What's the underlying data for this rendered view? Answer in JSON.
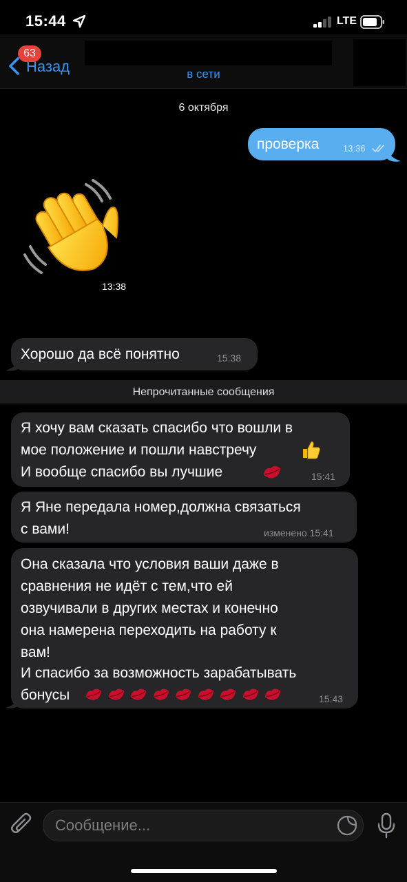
{
  "status_bar": {
    "time": "15:44",
    "network": "LTE"
  },
  "header": {
    "back_badge": "63",
    "back_label": "Назад",
    "contact_status": "в сети"
  },
  "chat": {
    "date_separator": "6 октября",
    "outgoing": {
      "text": "проверка",
      "time": "13:36"
    },
    "sticker": {
      "time": "13:38",
      "icon": "waving-hand"
    },
    "incoming_1": {
      "text": "Хорошо да всё понятно",
      "time": "15:38"
    },
    "unread_label": "Непрочитанные сообщения",
    "incoming_2": {
      "lines": [
        "Я хочу вам сказать спасибо что вошли в",
        "мое положение и пошли навстречу",
        "И вообще спасибо вы лучшие"
      ],
      "time": "15:41"
    },
    "incoming_3": {
      "lines": [
        "Я Яне передала номер,должна связаться",
        "с вами!"
      ],
      "time": "изменено 15:41"
    },
    "incoming_4": {
      "lines": [
        "Она сказала что условия ваши даже в",
        "сравнения не идёт с тем,что ей",
        "озвучивали в других местах и конечно",
        "она намерена переходить на работу к",
        "вам!",
        "И спасибо за возможность зарабатывать",
        "бонусы"
      ],
      "time": "15:43"
    }
  },
  "input": {
    "placeholder": "Сообщение..."
  },
  "colors": {
    "accent": "#3a93f0",
    "outgoing_bubble": "#59aeef",
    "incoming_bubble": "#262628",
    "badge": "#e5433c"
  }
}
